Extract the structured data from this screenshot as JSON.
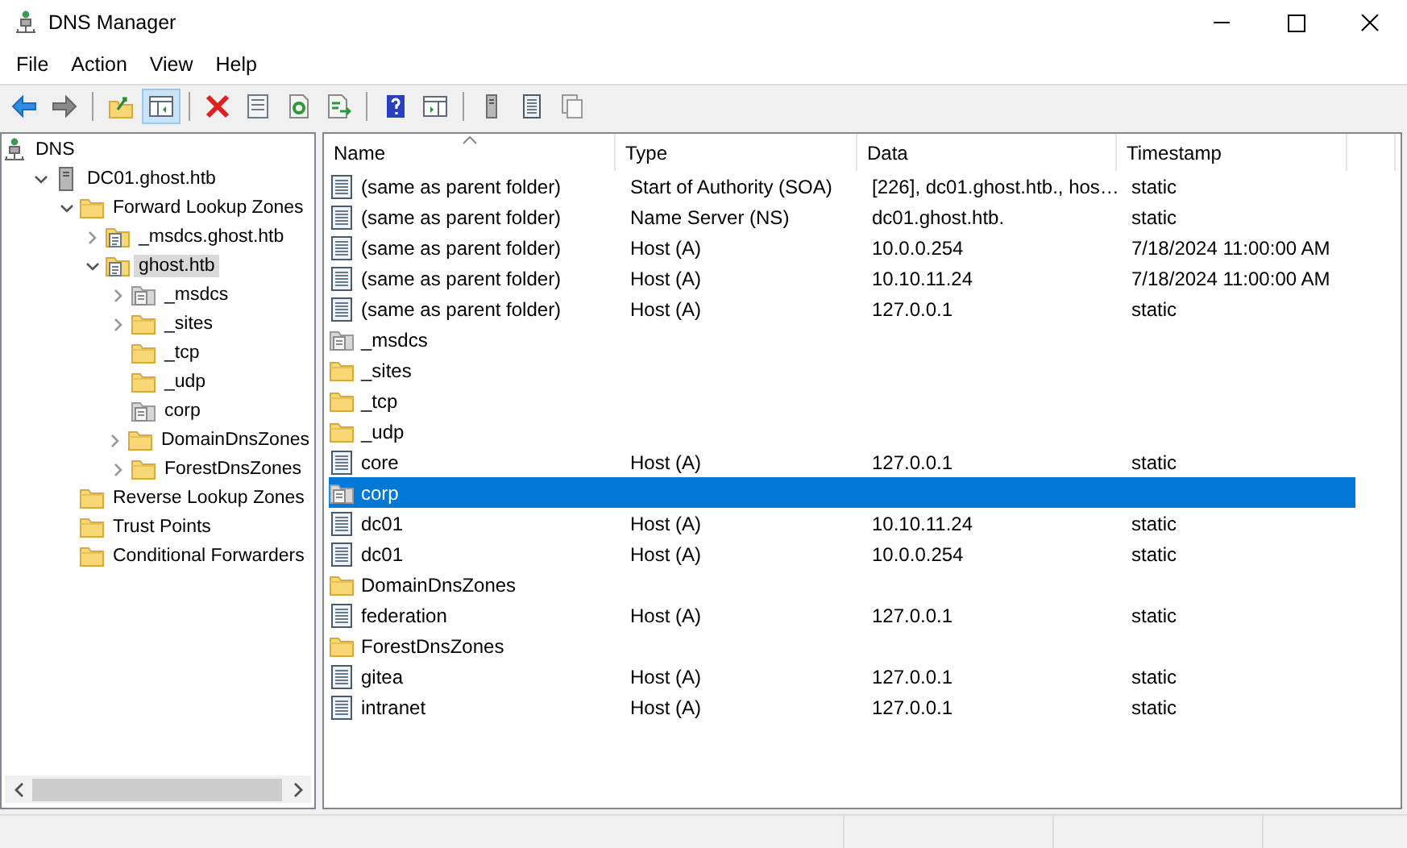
{
  "window": {
    "title": "DNS Manager"
  },
  "menu": [
    "File",
    "Action",
    "View",
    "Help"
  ],
  "toolbar": [
    {
      "kind": "back",
      "pressed": false
    },
    {
      "kind": "forward",
      "pressed": false
    },
    {
      "kind": "sep"
    },
    {
      "kind": "up",
      "pressed": false
    },
    {
      "kind": "tree",
      "pressed": true
    },
    {
      "kind": "sep"
    },
    {
      "kind": "delete",
      "pressed": false
    },
    {
      "kind": "properties",
      "pressed": false
    },
    {
      "kind": "refresh",
      "pressed": false
    },
    {
      "kind": "export",
      "pressed": false
    },
    {
      "kind": "sep"
    },
    {
      "kind": "help",
      "pressed": false
    },
    {
      "kind": "pane",
      "pressed": false
    },
    {
      "kind": "sep"
    },
    {
      "kind": "server",
      "pressed": false
    },
    {
      "kind": "list",
      "pressed": false
    },
    {
      "kind": "copy",
      "pressed": false
    }
  ],
  "tree": [
    {
      "label": "DNS",
      "kind": "dns",
      "selected": false,
      "children": [
        {
          "label": "DC01.ghost.htb",
          "kind": "server",
          "expanded": true,
          "selected": false,
          "children": [
            {
              "label": "Forward Lookup Zones",
              "kind": "folder",
              "expanded": true,
              "selected": false,
              "children": [
                {
                  "label": "_msdcs.ghost.htb",
                  "kind": "zone",
                  "expanded": false,
                  "selected": false
                },
                {
                  "label": "ghost.htb",
                  "kind": "zone",
                  "expanded": true,
                  "selected": true,
                  "children": [
                    {
                      "label": "_msdcs",
                      "kind": "delegation",
                      "expanded": false,
                      "selected": false
                    },
                    {
                      "label": "_sites",
                      "kind": "folder",
                      "expanded": false,
                      "selected": false
                    },
                    {
                      "label": "_tcp",
                      "kind": "folder",
                      "selected": false
                    },
                    {
                      "label": "_udp",
                      "kind": "folder",
                      "selected": false
                    },
                    {
                      "label": "corp",
                      "kind": "delegation",
                      "selected": false
                    },
                    {
                      "label": "DomainDnsZones",
                      "kind": "folder",
                      "expanded": false,
                      "selected": false
                    },
                    {
                      "label": "ForestDnsZones",
                      "kind": "folder",
                      "expanded": false,
                      "selected": false
                    }
                  ]
                }
              ]
            },
            {
              "label": "Reverse Lookup Zones",
              "kind": "folder",
              "selected": false
            },
            {
              "label": "Trust Points",
              "kind": "folder",
              "selected": false
            },
            {
              "label": "Conditional Forwarders",
              "kind": "folder",
              "selected": false
            }
          ]
        }
      ]
    }
  ],
  "table": {
    "columns": [
      "Name",
      "Type",
      "Data",
      "Timestamp"
    ],
    "rows": [
      {
        "kind": "record",
        "name": "(same as parent folder)",
        "type": "Start of Authority (SOA)",
        "data": "[226], dc01.ghost.htb., hos…",
        "timestamp": "static",
        "selected": false
      },
      {
        "kind": "record",
        "name": "(same as parent folder)",
        "type": "Name Server (NS)",
        "data": "dc01.ghost.htb.",
        "timestamp": "static",
        "selected": false
      },
      {
        "kind": "record",
        "name": "(same as parent folder)",
        "type": "Host (A)",
        "data": "10.0.0.254",
        "timestamp": "7/18/2024 11:00:00 AM",
        "selected": false
      },
      {
        "kind": "record",
        "name": "(same as parent folder)",
        "type": "Host (A)",
        "data": "10.10.11.24",
        "timestamp": "7/18/2024 11:00:00 AM",
        "selected": false
      },
      {
        "kind": "record",
        "name": "(same as parent folder)",
        "type": "Host (A)",
        "data": "127.0.0.1",
        "timestamp": "static",
        "selected": false
      },
      {
        "kind": "delegation",
        "name": "_msdcs",
        "selected": false
      },
      {
        "kind": "folder",
        "name": "_sites",
        "selected": false
      },
      {
        "kind": "folder",
        "name": "_tcp",
        "selected": false
      },
      {
        "kind": "folder",
        "name": "_udp",
        "selected": false
      },
      {
        "kind": "record",
        "name": "core",
        "type": "Host (A)",
        "data": "127.0.0.1",
        "timestamp": "static",
        "selected": false
      },
      {
        "kind": "delegation",
        "name": "corp",
        "selected": true
      },
      {
        "kind": "record",
        "name": "dc01",
        "type": "Host (A)",
        "data": "10.10.11.24",
        "timestamp": "static",
        "selected": false
      },
      {
        "kind": "record",
        "name": "dc01",
        "type": "Host (A)",
        "data": "10.0.0.254",
        "timestamp": "static",
        "selected": false
      },
      {
        "kind": "folder",
        "name": "DomainDnsZones",
        "selected": false
      },
      {
        "kind": "record",
        "name": "federation",
        "type": "Host (A)",
        "data": "127.0.0.1",
        "timestamp": "static",
        "selected": false
      },
      {
        "kind": "folder",
        "name": "ForestDnsZones",
        "selected": false
      },
      {
        "kind": "record",
        "name": "gitea",
        "type": "Host (A)",
        "data": "127.0.0.1",
        "timestamp": "static",
        "selected": false
      },
      {
        "kind": "record",
        "name": "intranet",
        "type": "Host (A)",
        "data": "127.0.0.1",
        "timestamp": "static",
        "selected": false
      }
    ]
  }
}
